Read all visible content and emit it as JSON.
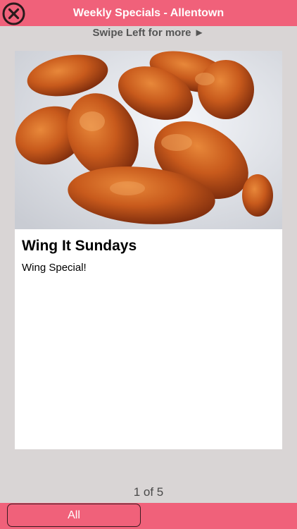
{
  "header": {
    "title": "Weekly Specials - Allentown",
    "close_icon": "close-circle-icon"
  },
  "swipe_hint": "Swipe Left for more ►",
  "card": {
    "title": "Wing It Sundays",
    "description": "Wing Special!"
  },
  "pager": {
    "label": "1 of 5"
  },
  "footer": {
    "filter_label": "All"
  },
  "colors": {
    "accent": "#f0617a",
    "background": "#d9d5d5"
  }
}
